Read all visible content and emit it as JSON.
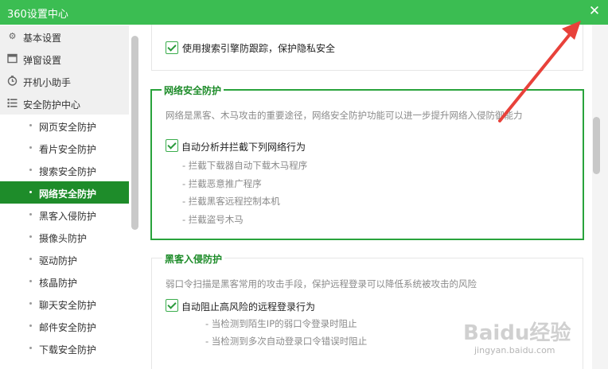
{
  "window": {
    "title": "360设置中心",
    "close_label": "✕"
  },
  "sidebar": {
    "main_items": [
      {
        "label": "基本设置",
        "icon": "gear-icon"
      },
      {
        "label": "弹窗设置",
        "icon": "window-icon"
      },
      {
        "label": "开机小助手",
        "icon": "timer-icon"
      },
      {
        "label": "安全防护中心",
        "icon": "list-icon"
      }
    ],
    "sub_items": [
      {
        "label": "网页安全防护"
      },
      {
        "label": "看片安全防护"
      },
      {
        "label": "搜索安全防护"
      },
      {
        "label": "网络安全防护",
        "active": true
      },
      {
        "label": "黑客入侵防护"
      },
      {
        "label": "摄像头防护"
      },
      {
        "label": "驱动防护"
      },
      {
        "label": "核晶防护"
      },
      {
        "label": "聊天安全防护"
      },
      {
        "label": "邮件安全防护"
      },
      {
        "label": "下载安全防护"
      }
    ]
  },
  "main": {
    "search_option": {
      "label": "使用搜索引擎防跟踪，保护隐私安全",
      "checked": true
    },
    "network_section": {
      "title": "网络安全防护",
      "description": "网络是黑客、木马攻击的重要途径，网络安全防护功能可以进一步提升网络入侵防御能力",
      "option": {
        "label": "自动分析并拦截下列网络行为",
        "checked": true
      },
      "items": [
        "- 拦截下载器自动下载木马程序",
        "- 拦截恶意推广程序",
        "- 拦截黑客远程控制本机",
        "- 拦截盗号木马"
      ]
    },
    "hacker_section": {
      "title": "黑客入侵防护",
      "description": "弱口令扫描是黑客常用的攻击手段，保护远程登录可以降低系统被攻击的风险",
      "option": {
        "label": "自动阻止高风险的远程登录行为",
        "checked": true
      },
      "items": [
        "- 当检测到陌生IP的弱口令登录时阻止",
        "- 当检测到多次自动登录口令错误时阻止"
      ]
    }
  },
  "watermark": {
    "text": "Baidu经验",
    "url": "jingyan.baidu.com"
  },
  "colors": {
    "titlebar": "#3bbd52",
    "active": "#1e8c2a",
    "accent": "#29a33c",
    "annotation_arrow": "#e8413a"
  }
}
